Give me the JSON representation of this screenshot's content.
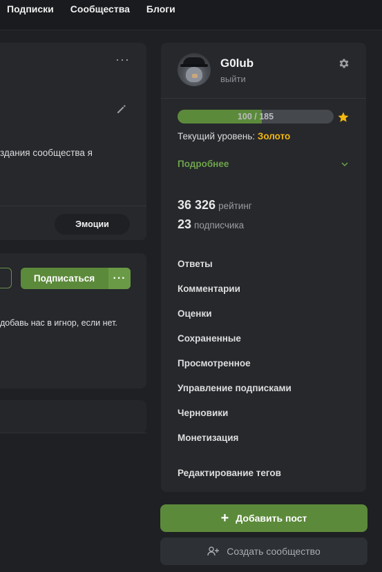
{
  "topnav": {
    "items": [
      "Подписки",
      "Сообщества",
      "Блоги"
    ]
  },
  "post": {
    "description": "здания сообщества я",
    "emotions_label": "Эмоции"
  },
  "community": {
    "subscribe_label": "Подписаться",
    "more_label": "···",
    "text": "добавь нас в игнор, если нет."
  },
  "profile": {
    "username": "G0lub",
    "logout_label": "выйти",
    "progress_text": "100 / 185",
    "progress_value": 100,
    "progress_max": 185,
    "level_prefix": "Текущий уровень:",
    "level_value": "Золото",
    "details_label": "Подробнее",
    "rating_value": "36 326",
    "rating_label": "рейтинг",
    "subscribers_value": "23",
    "subscribers_label": "подписчика"
  },
  "menu": {
    "items": [
      "Ответы",
      "Комментарии",
      "Оценки",
      "Сохраненные",
      "Просмотренное",
      "Управление подписками",
      "Черновики",
      "Монетизация"
    ],
    "edit_tags": "Редактирование тегов"
  },
  "actions": {
    "add_post": "Добавить пост",
    "create_community": "Создать сообщество"
  },
  "colors": {
    "accent_green": "#5c8a3b",
    "gold": "#f2b80f",
    "link_green": "#6ea34a",
    "card_bg": "#26282c"
  }
}
